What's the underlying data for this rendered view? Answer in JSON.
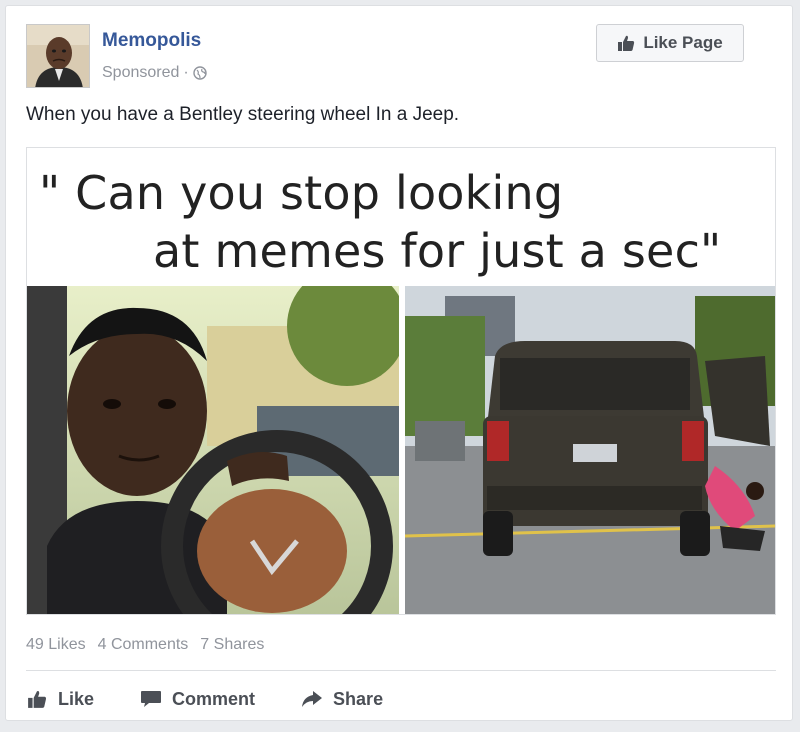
{
  "post": {
    "page_name": "Memopolis",
    "sponsored_label": "Sponsored",
    "separator": "·",
    "like_page_label": "Like Page",
    "text": "When you have a Bentley steering wheel In a Jeep."
  },
  "image": {
    "caption_line1": "\" Can you stop looking",
    "caption_line2": "at memes for just a sec\""
  },
  "stats": {
    "likes": "49 Likes",
    "comments": "4 Comments",
    "shares": "7 Shares"
  },
  "actions": {
    "like": "Like",
    "comment": "Comment",
    "share": "Share"
  },
  "colors": {
    "link": "#365899",
    "muted": "#90949c",
    "action": "#4b4f56"
  }
}
